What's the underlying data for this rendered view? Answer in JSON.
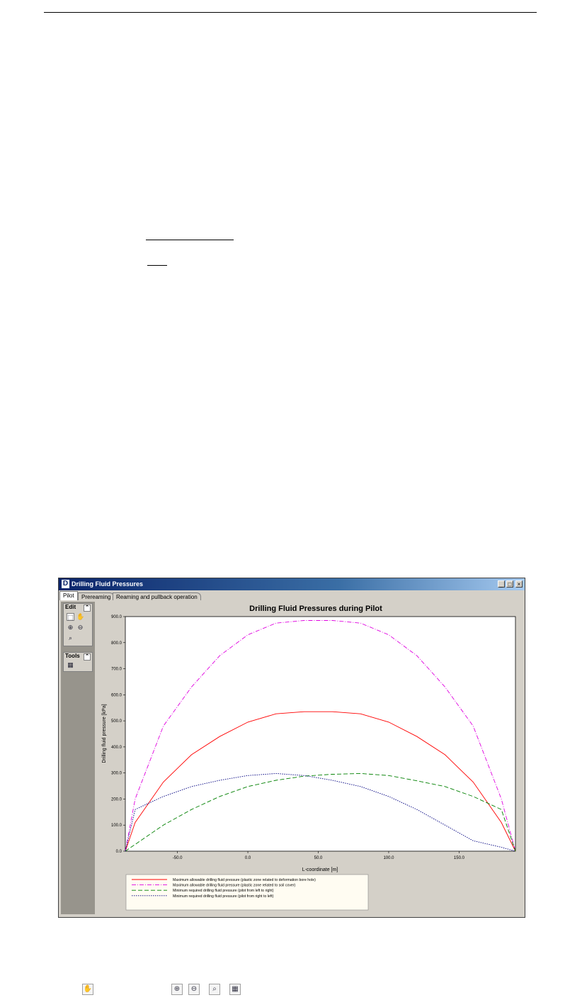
{
  "window": {
    "title": "Drilling Fluid Pressures",
    "buttons": {
      "minimize": "_",
      "maximize": "□",
      "close": "×"
    }
  },
  "tabs": [
    {
      "label": "Pilot",
      "active": true
    },
    {
      "label": "Prereaming",
      "active": false
    },
    {
      "label": "Reaming and pullback operation",
      "active": false
    }
  ],
  "sidebar": {
    "edit_panel": {
      "title": "Edit",
      "tools": [
        "select-icon",
        "hand-pan-icon",
        "zoom-in-icon",
        "zoom-out-icon",
        "zoom-window-icon"
      ]
    },
    "tools_panel": {
      "title": "Tools",
      "tools": [
        "zoom-extents-icon"
      ]
    }
  },
  "chart_data": {
    "type": "line",
    "title": "Drilling Fluid Pressures during Pilot",
    "xlabel": "L-coordinate [m]",
    "ylabel": "Drilling fluid pressure [kPa]",
    "xlim": [
      -87,
      190
    ],
    "ylim": [
      0,
      900
    ],
    "xticks": [
      -50,
      0,
      50,
      100,
      150
    ],
    "xtick_labels": [
      "-50.0",
      "0.0",
      "50.0",
      "100.0",
      "150.0"
    ],
    "yticks": [
      0,
      100,
      200,
      300,
      400,
      500,
      600,
      700,
      800,
      900
    ],
    "ytick_labels": [
      "0.0",
      "100.0",
      "200.0",
      "300.0",
      "400.0",
      "500.0",
      "600.0",
      "700.0",
      "800.0",
      "900.0"
    ],
    "grid": false,
    "legend_position": "bottom-left",
    "series": [
      {
        "name": "Maximum allowable drilling fluid pressure (plastic zone related to deformation bore hole)",
        "color": "#ff0000",
        "dash": "solid",
        "x": [
          -87,
          -80,
          -60,
          -40,
          -20,
          0,
          20,
          40,
          50,
          60,
          80,
          100,
          120,
          140,
          160,
          180,
          190
        ],
        "y": [
          0,
          110,
          265,
          370,
          440,
          495,
          527,
          535,
          535,
          535,
          527,
          495,
          440,
          370,
          265,
          110,
          0
        ]
      },
      {
        "name": "Maximum allowable drilling fluid pressure (plastic zone related to soil cover)",
        "color": "#e000e0",
        "dash": "dashdot",
        "x": [
          -87,
          -80,
          -60,
          -40,
          -20,
          0,
          20,
          40,
          50,
          60,
          80,
          100,
          120,
          140,
          160,
          180,
          190
        ],
        "y": [
          0,
          200,
          480,
          630,
          750,
          830,
          875,
          885,
          885,
          885,
          875,
          830,
          750,
          630,
          480,
          200,
          0
        ]
      },
      {
        "name": "Minimum required drilling fluid pressure (pilot from left to right)",
        "color": "#008000",
        "dash": "dashed",
        "x": [
          -87,
          -60,
          -40,
          -20,
          0,
          20,
          40,
          60,
          80,
          100,
          120,
          140,
          160,
          180,
          190
        ],
        "y": [
          0,
          100,
          160,
          210,
          248,
          272,
          288,
          295,
          298,
          290,
          270,
          248,
          210,
          160,
          0
        ]
      },
      {
        "name": "Minimum required drilling fluid pressure (pilot from right to left)",
        "color": "#000080",
        "dash": "dotted",
        "x": [
          -87,
          -80,
          -60,
          -40,
          -20,
          0,
          20,
          40,
          60,
          80,
          100,
          120,
          140,
          160,
          180,
          190
        ],
        "y": [
          0,
          160,
          210,
          248,
          272,
          290,
          298,
          290,
          272,
          248,
          210,
          160,
          100,
          40,
          15,
          0
        ]
      }
    ]
  },
  "below_icons": [
    "hand-pan-icon",
    "zoom-in-icon",
    "zoom-out-icon",
    "zoom-window-icon",
    "zoom-extents-icon"
  ]
}
